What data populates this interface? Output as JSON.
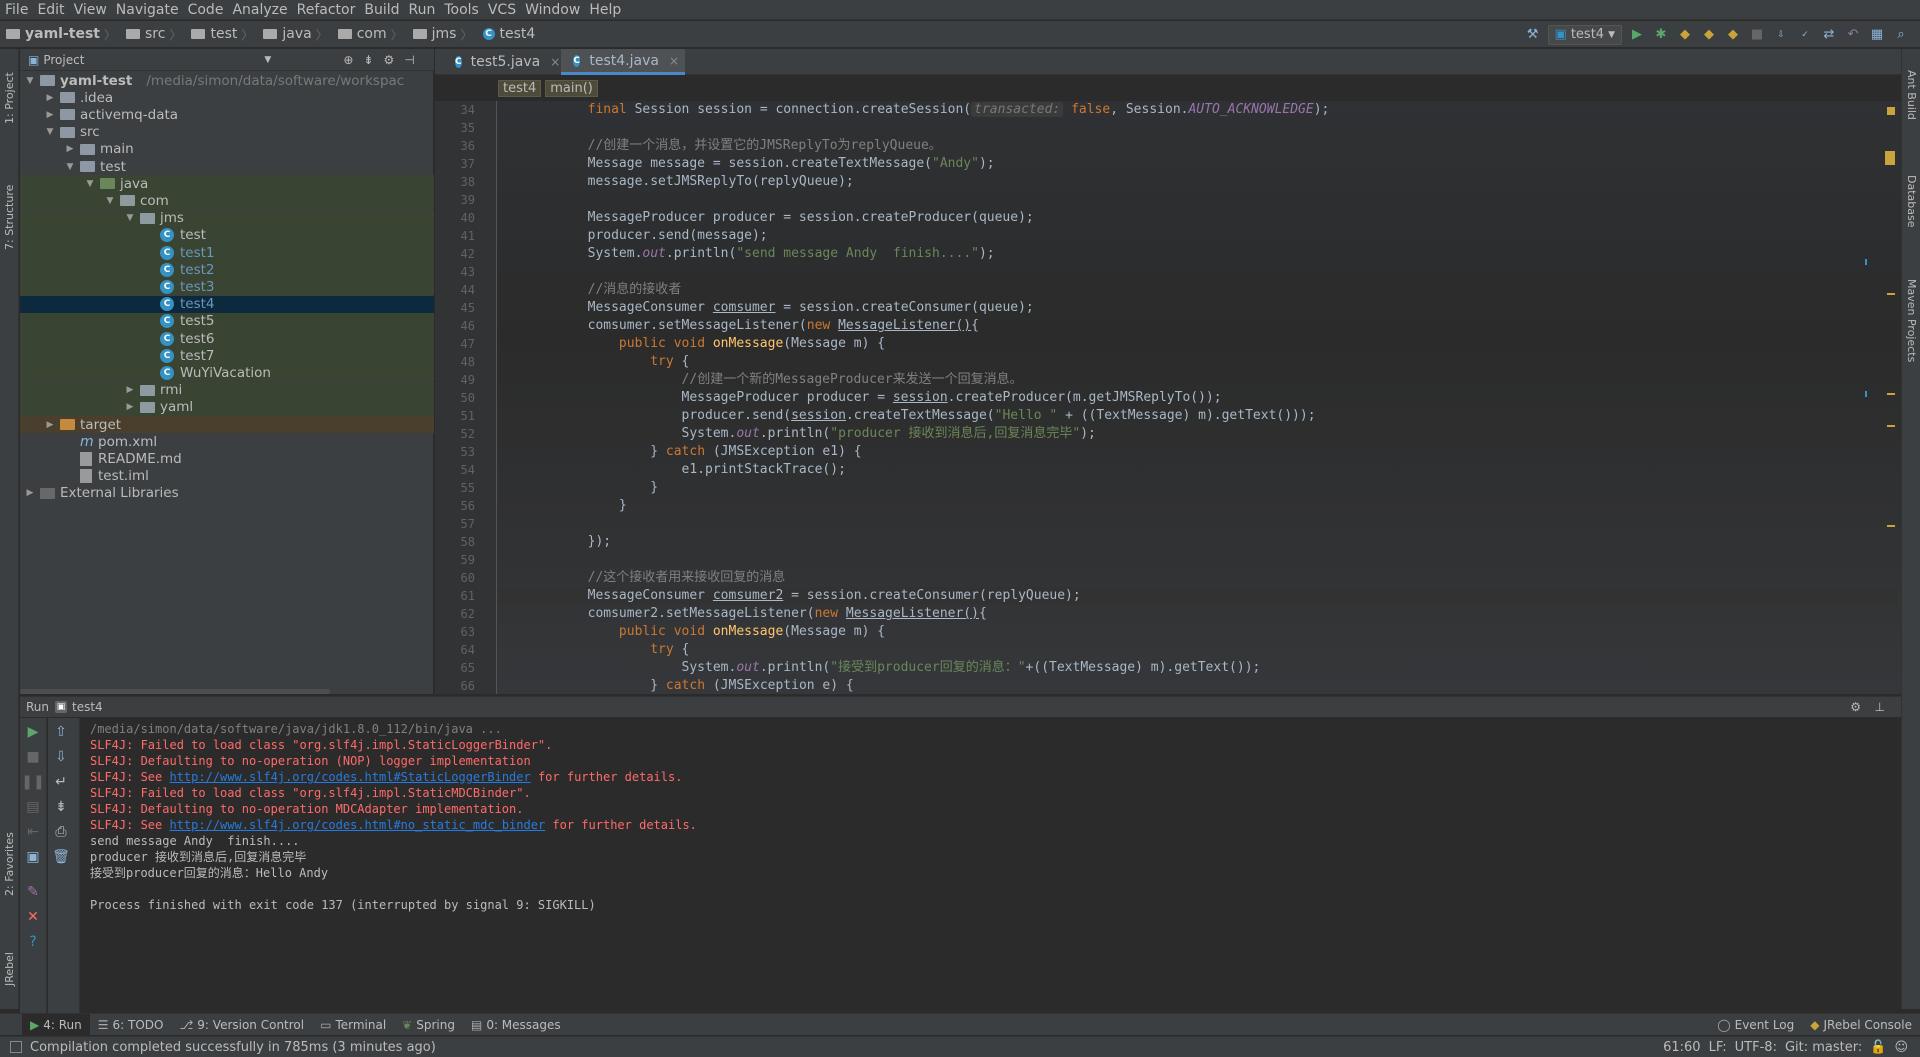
{
  "menu": [
    "File",
    "Edit",
    "View",
    "Navigate",
    "Code",
    "Analyze",
    "Refactor",
    "Build",
    "Run",
    "Tools",
    "VCS",
    "Window",
    "Help"
  ],
  "breadcrumbs": [
    "yaml-test",
    "src",
    "test",
    "java",
    "com",
    "jms",
    "test4"
  ],
  "run_config": "test4",
  "project_panel": {
    "title": "Project",
    "tree": [
      {
        "label": "yaml-test",
        "path": "/media/simon/data/software/workspac",
        "indent": 0,
        "arrow": "▼",
        "icon": "folder"
      },
      {
        "label": ".idea",
        "indent": 1,
        "arrow": "▶",
        "icon": "folder"
      },
      {
        "label": "activemq-data",
        "indent": 1,
        "arrow": "▶",
        "icon": "folder"
      },
      {
        "label": "src",
        "indent": 1,
        "arrow": "▼",
        "icon": "folder"
      },
      {
        "label": "main",
        "indent": 2,
        "arrow": "▶",
        "icon": "folder"
      },
      {
        "label": "test",
        "indent": 2,
        "arrow": "▼",
        "icon": "folder"
      },
      {
        "label": "java",
        "indent": 3,
        "arrow": "▼",
        "icon": "folder-green"
      },
      {
        "label": "com",
        "indent": 4,
        "arrow": "▼",
        "icon": "folder"
      },
      {
        "label": "jms",
        "indent": 5,
        "arrow": "▼",
        "icon": "folder"
      },
      {
        "label": "test",
        "indent": 6,
        "icon": "class"
      },
      {
        "label": "test1",
        "indent": 6,
        "icon": "class",
        "blue": true
      },
      {
        "label": "test2",
        "indent": 6,
        "icon": "class",
        "blue": true
      },
      {
        "label": "test3",
        "indent": 6,
        "icon": "class",
        "blue": true
      },
      {
        "label": "test4",
        "indent": 6,
        "icon": "class",
        "blue": true,
        "selected": true
      },
      {
        "label": "test5",
        "indent": 6,
        "icon": "class"
      },
      {
        "label": "test6",
        "indent": 6,
        "icon": "class"
      },
      {
        "label": "test7",
        "indent": 6,
        "icon": "class"
      },
      {
        "label": "WuYiVacation",
        "indent": 6,
        "icon": "class"
      },
      {
        "label": "rmi",
        "indent": 5,
        "arrow": "▶",
        "icon": "folder"
      },
      {
        "label": "yaml",
        "indent": 5,
        "arrow": "▶",
        "icon": "folder"
      },
      {
        "label": "target",
        "indent": 1,
        "arrow": "▶",
        "icon": "folder-orange",
        "orange": true
      },
      {
        "label": "pom.xml",
        "indent": 2,
        "icon": "maven"
      },
      {
        "label": "README.md",
        "indent": 2,
        "icon": "file"
      },
      {
        "label": "test.iml",
        "indent": 2,
        "icon": "file"
      },
      {
        "label": "External Libraries",
        "indent": 0,
        "arrow": "▶",
        "icon": "lib"
      }
    ]
  },
  "editor": {
    "tabs": [
      {
        "label": "test5.java",
        "active": false
      },
      {
        "label": "test4.java",
        "active": true
      }
    ],
    "breadcrumb": [
      "test4",
      "main()"
    ],
    "first_line": 34,
    "cursor_line": 61
  },
  "run_panel": {
    "title": "Run",
    "config": "test4",
    "console": [
      {
        "t": "/media/simon/data/software/java/jdk1.8.0_112/bin/java ...",
        "k": "path"
      },
      {
        "t": "SLF4J: Failed to load class \"org.slf4j.impl.StaticLoggerBinder\".",
        "k": "err"
      },
      {
        "t": "SLF4J: Defaulting to no-operation (NOP) logger implementation",
        "k": "err"
      },
      {
        "t": "SLF4J: See ",
        "k": "err",
        "link": "http://www.slf4j.org/codes.html#StaticLoggerBinder",
        "after": " for further details."
      },
      {
        "t": "SLF4J: Failed to load class \"org.slf4j.impl.StaticMDCBinder\".",
        "k": "err"
      },
      {
        "t": "SLF4J: Defaulting to no-operation MDCAdapter implementation.",
        "k": "err"
      },
      {
        "t": "SLF4J: See ",
        "k": "err",
        "link": "http://www.slf4j.org/codes.html#no_static_mdc_binder",
        "after": " for further details."
      },
      {
        "t": "send message Andy  finish....",
        "k": "out"
      },
      {
        "t": "producer 接收到消息后,回复消息完毕",
        "k": "out"
      },
      {
        "t": "接受到producer回复的消息：Hello Andy",
        "k": "out"
      },
      {
        "t": "",
        "k": "out"
      },
      {
        "t": "Process finished with exit code 137 (interrupted by signal 9: SIGKILL)",
        "k": "out"
      }
    ]
  },
  "left_tabs": [
    "1: Project",
    "7: Structure",
    "2: Favorites",
    "JRebel"
  ],
  "right_tabs": [
    "Ant Build",
    "Database",
    "Maven Projects"
  ],
  "bottom_tabs": [
    {
      "label": "4: Run",
      "active": true
    },
    {
      "label": "6: TODO"
    },
    {
      "label": "9: Version Control"
    },
    {
      "label": "Terminal"
    },
    {
      "label": "Spring"
    },
    {
      "label": "0: Messages"
    }
  ],
  "bottom_right_tabs": [
    "Event Log",
    "JRebel Console"
  ],
  "status": {
    "message": "Compilation completed successfully in 785ms (3 minutes ago)",
    "position": "61:60",
    "line_sep": "LF:",
    "encoding": "UTF-8:",
    "git": "Git: master:"
  },
  "colors": {
    "accent": "#4a88c7",
    "selection": "#0d293e",
    "error": "#ff6b68"
  }
}
